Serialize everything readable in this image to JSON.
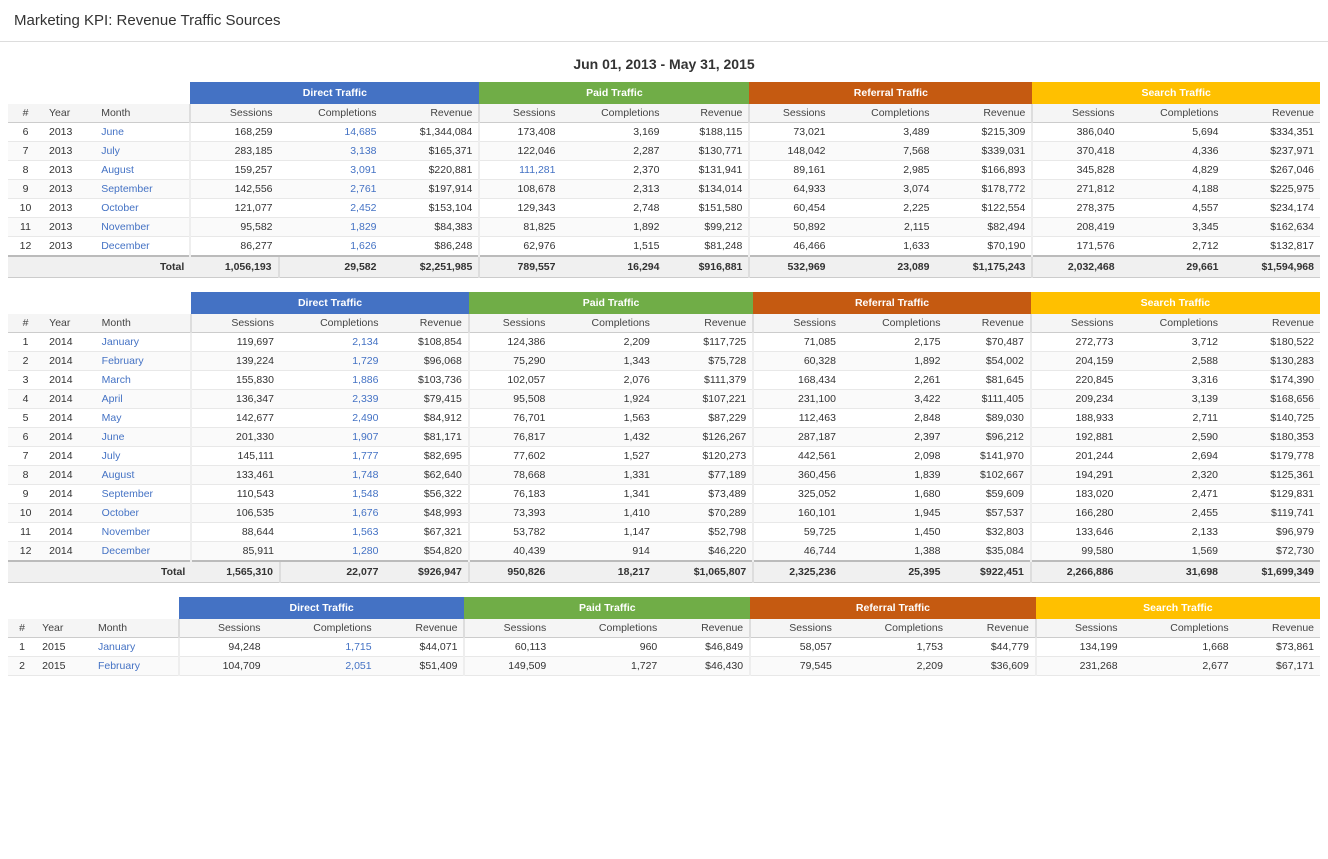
{
  "page": {
    "title": "Marketing KPI: Revenue Traffic Sources",
    "dateRange": "Jun 01, 2013 - May 31, 2015"
  },
  "columnHeaders": {
    "directTraffic": "Direct Traffic",
    "paidTraffic": "Paid Traffic",
    "referralTraffic": "Referral Traffic",
    "searchTraffic": "Search Traffic"
  },
  "subHeaders": {
    "num": "#",
    "year": "Year",
    "month": "Month",
    "sessions": "Sessions",
    "completions": "Completions",
    "revenue": "Revenue"
  },
  "tables": [
    {
      "id": "2013",
      "rows": [
        {
          "num": "6",
          "year": "2013",
          "month": "June",
          "d_sessions": "168,259",
          "d_completions": "14,685",
          "d_revenue": "$1,344,084",
          "p_sessions": "173,408",
          "p_completions": "3,169",
          "p_revenue": "$188,115",
          "r_sessions": "73,021",
          "r_completions": "3,489",
          "r_revenue": "$215,309",
          "s_sessions": "386,040",
          "s_completions": "5,694",
          "s_revenue": "$334,351"
        },
        {
          "num": "7",
          "year": "2013",
          "month": "July",
          "d_sessions": "283,185",
          "d_completions": "3,138",
          "d_revenue": "$165,371",
          "p_sessions": "122,046",
          "p_completions": "2,287",
          "p_revenue": "$130,771",
          "r_sessions": "148,042",
          "r_completions": "7,568",
          "r_revenue": "$339,031",
          "s_sessions": "370,418",
          "s_completions": "4,336",
          "s_revenue": "$237,971"
        },
        {
          "num": "8",
          "year": "2013",
          "month": "August",
          "d_sessions": "159,257",
          "d_completions": "3,091",
          "d_revenue": "$220,881",
          "p_sessions": "111,281",
          "p_completions": "2,370",
          "p_revenue": "$131,941",
          "r_sessions": "89,161",
          "r_completions": "2,985",
          "r_revenue": "$166,893",
          "s_sessions": "345,828",
          "s_completions": "4,829",
          "s_revenue": "$267,046"
        },
        {
          "num": "9",
          "year": "2013",
          "month": "September",
          "d_sessions": "142,556",
          "d_completions": "2,761",
          "d_revenue": "$197,914",
          "p_sessions": "108,678",
          "p_completions": "2,313",
          "p_revenue": "$134,014",
          "r_sessions": "64,933",
          "r_completions": "3,074",
          "r_revenue": "$178,772",
          "s_sessions": "271,812",
          "s_completions": "4,188",
          "s_revenue": "$225,975"
        },
        {
          "num": "10",
          "year": "2013",
          "month": "October",
          "d_sessions": "121,077",
          "d_completions": "2,452",
          "d_revenue": "$153,104",
          "p_sessions": "129,343",
          "p_completions": "2,748",
          "p_revenue": "$151,580",
          "r_sessions": "60,454",
          "r_completions": "2,225",
          "r_revenue": "$122,554",
          "s_sessions": "278,375",
          "s_completions": "4,557",
          "s_revenue": "$234,174"
        },
        {
          "num": "11",
          "year": "2013",
          "month": "November",
          "d_sessions": "95,582",
          "d_completions": "1,829",
          "d_revenue": "$84,383",
          "p_sessions": "81,825",
          "p_completions": "1,892",
          "p_revenue": "$99,212",
          "r_sessions": "50,892",
          "r_completions": "2,115",
          "r_revenue": "$82,494",
          "s_sessions": "208,419",
          "s_completions": "3,345",
          "s_revenue": "$162,634"
        },
        {
          "num": "12",
          "year": "2013",
          "month": "December",
          "d_sessions": "86,277",
          "d_completions": "1,626",
          "d_revenue": "$86,248",
          "p_sessions": "62,976",
          "p_completions": "1,515",
          "p_revenue": "$81,248",
          "r_sessions": "46,466",
          "r_completions": "1,633",
          "r_revenue": "$70,190",
          "s_sessions": "171,576",
          "s_completions": "2,712",
          "s_revenue": "$132,817"
        }
      ],
      "total": {
        "label": "Total",
        "d_sessions": "1,056,193",
        "d_completions": "29,582",
        "d_revenue": "$2,251,985",
        "p_sessions": "789,557",
        "p_completions": "16,294",
        "p_revenue": "$916,881",
        "r_sessions": "532,969",
        "r_completions": "23,089",
        "r_revenue": "$1,175,243",
        "s_sessions": "2,032,468",
        "s_completions": "29,661",
        "s_revenue": "$1,594,968"
      }
    },
    {
      "id": "2014",
      "rows": [
        {
          "num": "1",
          "year": "2014",
          "month": "January",
          "d_sessions": "119,697",
          "d_completions": "2,134",
          "d_revenue": "$108,854",
          "p_sessions": "124,386",
          "p_completions": "2,209",
          "p_revenue": "$117,725",
          "r_sessions": "71,085",
          "r_completions": "2,175",
          "r_revenue": "$70,487",
          "s_sessions": "272,773",
          "s_completions": "3,712",
          "s_revenue": "$180,522"
        },
        {
          "num": "2",
          "year": "2014",
          "month": "February",
          "d_sessions": "139,224",
          "d_completions": "1,729",
          "d_revenue": "$96,068",
          "p_sessions": "75,290",
          "p_completions": "1,343",
          "p_revenue": "$75,728",
          "r_sessions": "60,328",
          "r_completions": "1,892",
          "r_revenue": "$54,002",
          "s_sessions": "204,159",
          "s_completions": "2,588",
          "s_revenue": "$130,283"
        },
        {
          "num": "3",
          "year": "2014",
          "month": "March",
          "d_sessions": "155,830",
          "d_completions": "1,886",
          "d_revenue": "$103,736",
          "p_sessions": "102,057",
          "p_completions": "2,076",
          "p_revenue": "$111,379",
          "r_sessions": "168,434",
          "r_completions": "2,261",
          "r_revenue": "$81,645",
          "s_sessions": "220,845",
          "s_completions": "3,316",
          "s_revenue": "$174,390"
        },
        {
          "num": "4",
          "year": "2014",
          "month": "April",
          "d_sessions": "136,347",
          "d_completions": "2,339",
          "d_revenue": "$79,415",
          "p_sessions": "95,508",
          "p_completions": "1,924",
          "p_revenue": "$107,221",
          "r_sessions": "231,100",
          "r_completions": "3,422",
          "r_revenue": "$111,405",
          "s_sessions": "209,234",
          "s_completions": "3,139",
          "s_revenue": "$168,656"
        },
        {
          "num": "5",
          "year": "2014",
          "month": "May",
          "d_sessions": "142,677",
          "d_completions": "2,490",
          "d_revenue": "$84,912",
          "p_sessions": "76,701",
          "p_completions": "1,563",
          "p_revenue": "$87,229",
          "r_sessions": "112,463",
          "r_completions": "2,848",
          "r_revenue": "$89,030",
          "s_sessions": "188,933",
          "s_completions": "2,711",
          "s_revenue": "$140,725"
        },
        {
          "num": "6",
          "year": "2014",
          "month": "June",
          "d_sessions": "201,330",
          "d_completions": "1,907",
          "d_revenue": "$81,171",
          "p_sessions": "76,817",
          "p_completions": "1,432",
          "p_revenue": "$126,267",
          "r_sessions": "287,187",
          "r_completions": "2,397",
          "r_revenue": "$96,212",
          "s_sessions": "192,881",
          "s_completions": "2,590",
          "s_revenue": "$180,353"
        },
        {
          "num": "7",
          "year": "2014",
          "month": "July",
          "d_sessions": "145,111",
          "d_completions": "1,777",
          "d_revenue": "$82,695",
          "p_sessions": "77,602",
          "p_completions": "1,527",
          "p_revenue": "$120,273",
          "r_sessions": "442,561",
          "r_completions": "2,098",
          "r_revenue": "$141,970",
          "s_sessions": "201,244",
          "s_completions": "2,694",
          "s_revenue": "$179,778"
        },
        {
          "num": "8",
          "year": "2014",
          "month": "August",
          "d_sessions": "133,461",
          "d_completions": "1,748",
          "d_revenue": "$62,640",
          "p_sessions": "78,668",
          "p_completions": "1,331",
          "p_revenue": "$77,189",
          "r_sessions": "360,456",
          "r_completions": "1,839",
          "r_revenue": "$102,667",
          "s_sessions": "194,291",
          "s_completions": "2,320",
          "s_revenue": "$125,361"
        },
        {
          "num": "9",
          "year": "2014",
          "month": "September",
          "d_sessions": "110,543",
          "d_completions": "1,548",
          "d_revenue": "$56,322",
          "p_sessions": "76,183",
          "p_completions": "1,341",
          "p_revenue": "$73,489",
          "r_sessions": "325,052",
          "r_completions": "1,680",
          "r_revenue": "$59,609",
          "s_sessions": "183,020",
          "s_completions": "2,471",
          "s_revenue": "$129,831"
        },
        {
          "num": "10",
          "year": "2014",
          "month": "October",
          "d_sessions": "106,535",
          "d_completions": "1,676",
          "d_revenue": "$48,993",
          "p_sessions": "73,393",
          "p_completions": "1,410",
          "p_revenue": "$70,289",
          "r_sessions": "160,101",
          "r_completions": "1,945",
          "r_revenue": "$57,537",
          "s_sessions": "166,280",
          "s_completions": "2,455",
          "s_revenue": "$119,741"
        },
        {
          "num": "11",
          "year": "2014",
          "month": "November",
          "d_sessions": "88,644",
          "d_completions": "1,563",
          "d_revenue": "$67,321",
          "p_sessions": "53,782",
          "p_completions": "1,147",
          "p_revenue": "$52,798",
          "r_sessions": "59,725",
          "r_completions": "1,450",
          "r_revenue": "$32,803",
          "s_sessions": "133,646",
          "s_completions": "2,133",
          "s_revenue": "$96,979"
        },
        {
          "num": "12",
          "year": "2014",
          "month": "December",
          "d_sessions": "85,911",
          "d_completions": "1,280",
          "d_revenue": "$54,820",
          "p_sessions": "40,439",
          "p_completions": "914",
          "p_revenue": "$46,220",
          "r_sessions": "46,744",
          "r_completions": "1,388",
          "r_revenue": "$35,084",
          "s_sessions": "99,580",
          "s_completions": "1,569",
          "s_revenue": "$72,730"
        }
      ],
      "total": {
        "label": "Total",
        "d_sessions": "1,565,310",
        "d_completions": "22,077",
        "d_revenue": "$926,947",
        "p_sessions": "950,826",
        "p_completions": "18,217",
        "p_revenue": "$1,065,807",
        "r_sessions": "2,325,236",
        "r_completions": "25,395",
        "r_revenue": "$922,451",
        "s_sessions": "2,266,886",
        "s_completions": "31,698",
        "s_revenue": "$1,699,349"
      }
    },
    {
      "id": "2015",
      "rows": [
        {
          "num": "1",
          "year": "2015",
          "month": "January",
          "d_sessions": "94,248",
          "d_completions": "1,715",
          "d_revenue": "$44,071",
          "p_sessions": "60,113",
          "p_completions": "960",
          "p_revenue": "$46,849",
          "r_sessions": "58,057",
          "r_completions": "1,753",
          "r_revenue": "$44,779",
          "s_sessions": "134,199",
          "s_completions": "1,668",
          "s_revenue": "$73,861"
        },
        {
          "num": "2",
          "year": "2015",
          "month": "February",
          "d_sessions": "104,709",
          "d_completions": "2,051",
          "d_revenue": "$51,409",
          "p_sessions": "149,509",
          "p_completions": "1,727",
          "p_revenue": "$46,430",
          "r_sessions": "79,545",
          "r_completions": "2,209",
          "r_revenue": "$36,609",
          "s_sessions": "231,268",
          "s_completions": "2,677",
          "s_revenue": "$67,171"
        }
      ],
      "total": null
    }
  ]
}
